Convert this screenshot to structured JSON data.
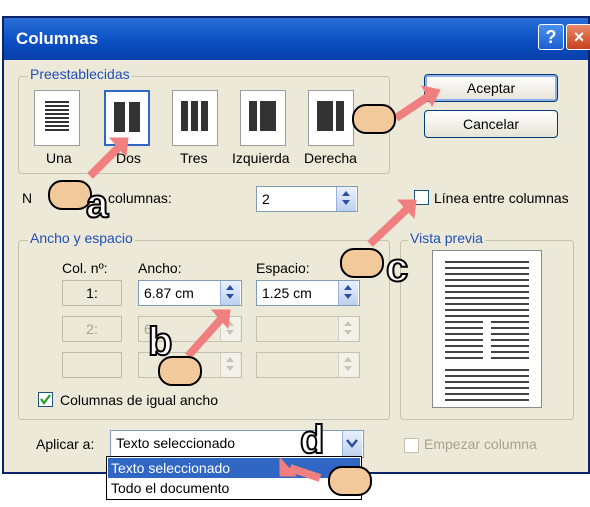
{
  "window": {
    "title": "Columnas",
    "help_glyph": "?",
    "close_glyph": "×"
  },
  "presets": {
    "group_label": "Preestablecidas",
    "items": [
      {
        "label": "Una",
        "selected": false
      },
      {
        "label": "Dos",
        "selected": true
      },
      {
        "label": "Tres",
        "selected": false
      },
      {
        "label": "Izquierda",
        "selected": false
      },
      {
        "label": "Derecha",
        "selected": false
      }
    ]
  },
  "buttons": {
    "ok": "Aceptar",
    "cancel": "Cancelar"
  },
  "num_columns": {
    "label_prefix": "N",
    "label_suffix": "columnas:",
    "value": "2"
  },
  "line_between": {
    "label": "Línea entre columnas",
    "checked": false
  },
  "width_spacing": {
    "group_label": "Ancho y espacio",
    "col_header": "Col. nº:",
    "width_header": "Ancho:",
    "space_header": "Espacio:",
    "rows": [
      {
        "col": "1:",
        "width": "6.87 cm",
        "space": "1.25 cm",
        "enabled": true
      },
      {
        "col": "2:",
        "width": "6",
        "space": "",
        "enabled": false
      },
      {
        "col": "",
        "width": "",
        "space": "",
        "enabled": false
      }
    ],
    "equal_width": {
      "label": "Columnas de igual ancho",
      "checked": true
    }
  },
  "preview": {
    "group_label": "Vista previa"
  },
  "apply": {
    "label": "Aplicar a:",
    "value": "Texto seleccionado",
    "options": [
      "Texto seleccionado",
      "Todo el documento"
    ]
  },
  "start_column": {
    "label": "Empezar columna",
    "checked": false
  },
  "callouts": [
    "a",
    "b",
    "c",
    "d"
  ],
  "colors": {
    "accent": "#f08080",
    "title_bar": "#0b4fc4",
    "group_label": "#1f4fb8",
    "selection": "#3167c4"
  }
}
